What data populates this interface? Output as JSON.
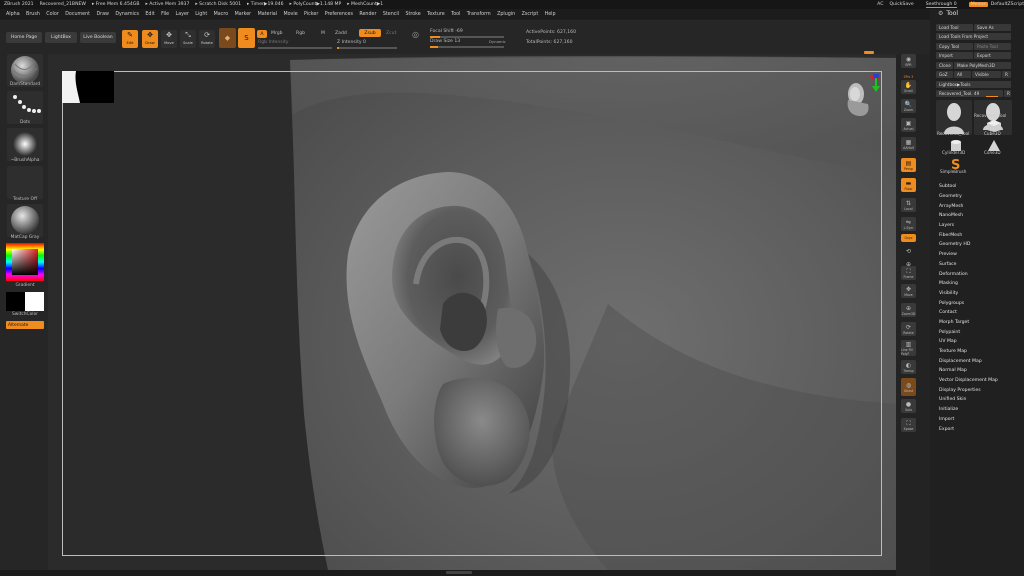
{
  "titlebar": {
    "items": [
      "ZBrush 2021",
      "Recovered_21BNEW",
      "▸ Free Mem 6.454GB",
      "▸ Active Mem 3937",
      "▸ Scratch Disk 5001",
      "▸ Timer▶19.046",
      "▸ PolyCount▶1.148 MP",
      "▸ MeshCount▶1"
    ],
    "ac": "AC",
    "quicksave": "QuickSave",
    "seethrough": "Seethrough  0",
    "menus": "Menus",
    "defaultzscript": "DefaultZScript"
  },
  "menubar": {
    "items": [
      "Alpha",
      "Brush",
      "Color",
      "Document",
      "Draw",
      "Dynamics",
      "Edit",
      "File",
      "Layer",
      "Light",
      "Macro",
      "Marker",
      "Material",
      "Movie",
      "Picker",
      "Preferences",
      "Render",
      "Stencil",
      "Stroke",
      "Texture",
      "Tool",
      "Transform",
      "Zplugin",
      "Zscript",
      "Help"
    ]
  },
  "toolbar": {
    "home_page": "Home Page",
    "lightbox": "LightBox",
    "live_boolean": "Live Boolean",
    "edit": "Edit",
    "draw": "Draw",
    "move": "Move",
    "scale": "Scale",
    "rotate": "Rotate",
    "a_label": "A",
    "mrgb": "Mrgb",
    "rgb": "Rgb",
    "m": "M",
    "zadd": "Zadd",
    "zsub": "Zsub",
    "zcut": "Zcut",
    "rgb_intensity": "Rgb Intensity",
    "z_intensity": "Z Intensity 0",
    "focal_shift": "Focal Shift -69",
    "draw_size": "Draw Size 13",
    "dynamic": "Dynamic",
    "active_points": "ActivePoints: 627,160",
    "total_points": "TotalPoints: 627,160"
  },
  "leftshelf": {
    "brush": "DamStandard",
    "stroke": "Dots",
    "alpha": "~BrushAlpha",
    "texture": "Texture Off",
    "material": "MatCap Gray",
    "gradient": "Gradient",
    "switch_color": "SwitchColor",
    "alternate": "Alternate"
  },
  "rightcol": {
    "icons": [
      {
        "name": "bpr-icon",
        "label": "BPR"
      },
      {
        "name": "spix-icon",
        "label": "SPix 3"
      },
      {
        "name": "scroll-icon",
        "label": "Scroll"
      },
      {
        "name": "zoom-icon",
        "label": "Zoom"
      },
      {
        "name": "actual-icon",
        "label": "Actual"
      },
      {
        "name": "aahalf-icon",
        "label": "AAHalf"
      },
      {
        "name": "persp-icon",
        "label": "Persp"
      },
      {
        "name": "floor-icon",
        "label": "Floor"
      },
      {
        "name": "local-icon",
        "label": "Local"
      },
      {
        "name": "lsym-icon",
        "label": "L.Sym"
      },
      {
        "name": "xyz-icon",
        "label": "Gxyz"
      },
      {
        "name": "frame-icon",
        "label": "Frame"
      },
      {
        "name": "move-icon",
        "label": "Move"
      },
      {
        "name": "zoom3d-icon",
        "label": "Zoom3D"
      },
      {
        "name": "rotate-icon",
        "label": "Rotate"
      },
      {
        "name": "linefill-icon",
        "label": "Line Fill PolyF"
      },
      {
        "name": "transp-icon",
        "label": "Transp"
      },
      {
        "name": "ghost-icon",
        "label": "Ghost"
      },
      {
        "name": "solo-icon",
        "label": "Solo"
      },
      {
        "name": "xpose-icon",
        "label": "Xpose"
      }
    ]
  },
  "palette": {
    "title": "Tool",
    "load_tool": "Load Tool",
    "save_as": "Save As",
    "load_tools_from_project": "Load Tools From Project",
    "copy_tool": "Copy Tool",
    "paste_tool": "Paste Tool",
    "import": "Import",
    "export": "Export",
    "clone": "Clone",
    "make_polymesh": "Make PolyMesh3D",
    "goz": "GoZ",
    "all": "All",
    "visible": "Visible",
    "r": "R",
    "lightbox_tools": "Lightbox▶Tools",
    "recovered_tool": "Recovered_Tool. 49",
    "slider_val": "R",
    "thumbs": [
      {
        "name": "recovered-tool-thumb",
        "label": "Recovered_Tool"
      },
      {
        "name": "recovered-tool2-thumb",
        "label": "Recovered_Tool"
      },
      {
        "name": "cube3d-thumb",
        "label": "Cube3D"
      },
      {
        "name": "cylinder3d-thumb",
        "label": "Cylinder3D"
      },
      {
        "name": "cone3d-thumb",
        "label": "Cone3D"
      },
      {
        "name": "simplebrush-thumb",
        "label": "SimpleBrush"
      }
    ],
    "subpalettes": [
      "Subtool",
      "Geometry",
      "ArrayMesh",
      "NanoMesh",
      "Layers",
      "FiberMesh",
      "Geometry HD",
      "Preview",
      "Surface",
      "Deformation",
      "Masking",
      "Visibility",
      "Polygroups",
      "Contact",
      "Morph Target",
      "Polypaint",
      "UV Map",
      "Texture Map",
      "Displacement Map",
      "Normal Map",
      "Vector Displacement Map",
      "Display Properties",
      "Unified Skin",
      "Initialize",
      "Import",
      "Export"
    ]
  },
  "colors": {
    "accent": "#f08c1e",
    "panel": "#262626",
    "viewport": "#2b2b2b"
  }
}
